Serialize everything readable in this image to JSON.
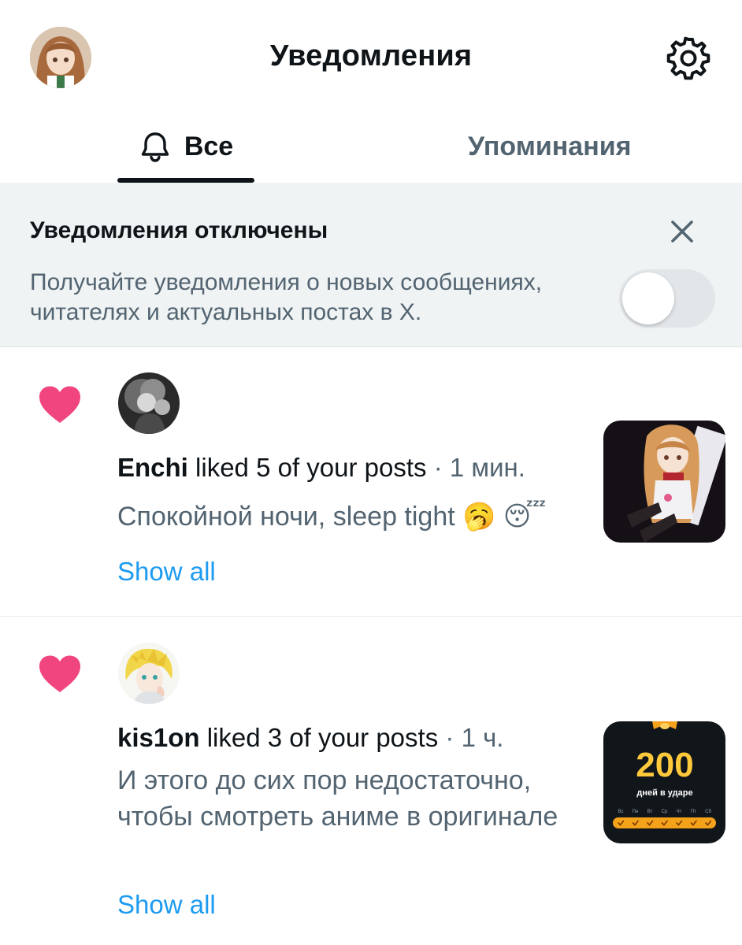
{
  "header": {
    "title": "Уведомления",
    "avatar_icon": "user-avatar-anime",
    "settings_icon": "gear-icon"
  },
  "tabs": [
    {
      "label": "Все",
      "icon": "bell-icon",
      "active": true
    },
    {
      "label": "Упоминания",
      "active": false
    }
  ],
  "banner": {
    "title": "Уведомления отключены",
    "text": "Получайте уведомления о новых сообщениях, читателях и актуальных постах в X.",
    "toggle_on": false,
    "close_icon": "close-icon"
  },
  "notifications": [
    {
      "type_icon": "heart-icon",
      "user": "Enchi",
      "action": "liked 5 of your posts",
      "separator": "·",
      "time": "1 мин.",
      "post_text": "Спокойной ночи, sleep tight 🥱 😴",
      "show_all": "Show all"
    },
    {
      "type_icon": "heart-icon",
      "user": "kis1on",
      "action": "liked 3 of your posts",
      "separator": "·",
      "time": "1 ч.",
      "post_text": "И этого до сих пор недостаточно, чтобы смотреть аниме в оригинале",
      "show_all": "Show all",
      "thumb": {
        "big_number": "200",
        "caption": "дней в ударе",
        "weekdays": [
          "Вс",
          "Пн",
          "Вт",
          "Ср",
          "Чт",
          "Пт",
          "Сб"
        ]
      }
    }
  ],
  "colors": {
    "accent": "#1d9bf0",
    "heart": "#f0457f",
    "text_primary": "#0f1419",
    "text_secondary": "#536471",
    "banner_bg": "#eff3f4",
    "streak_orange": "#f5a21b"
  }
}
